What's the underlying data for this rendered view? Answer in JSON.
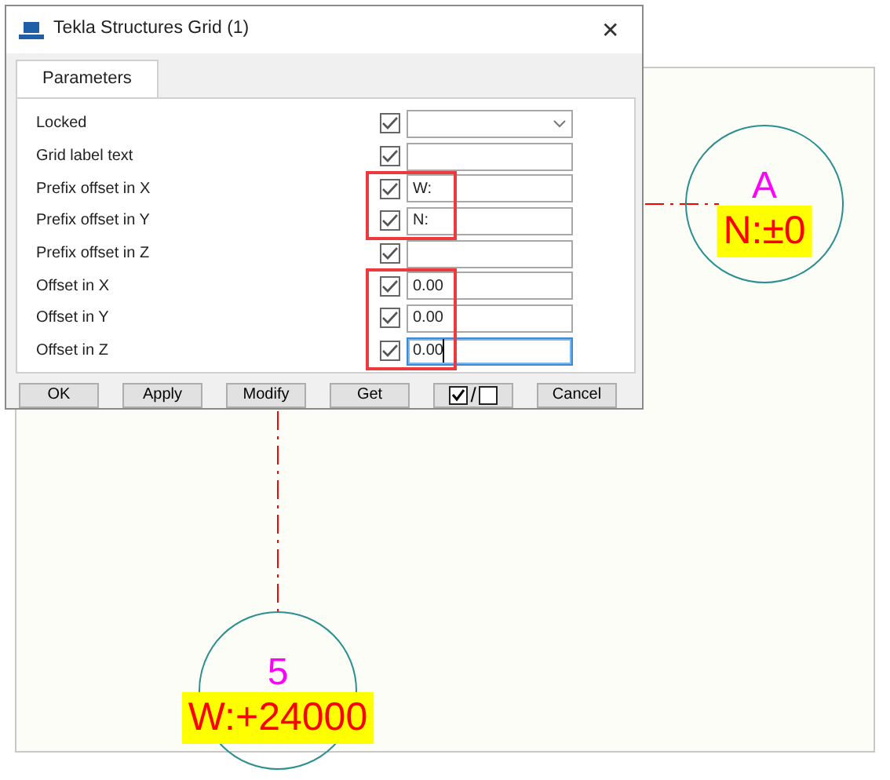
{
  "window": {
    "title": "Tekla Structures  Grid (1)",
    "close": "✕"
  },
  "tabs": [
    {
      "label": "Parameters",
      "selected": true
    }
  ],
  "rows": [
    {
      "label": "Locked",
      "checked": true,
      "kind": "dropdown",
      "value": "",
      "highlighted": false,
      "focused": false
    },
    {
      "label": "Grid label text",
      "checked": true,
      "kind": "text",
      "value": "",
      "highlighted": false,
      "focused": false
    },
    {
      "label": "Prefix offset in X",
      "checked": true,
      "kind": "text",
      "value": "W:",
      "highlighted": true,
      "focused": false
    },
    {
      "label": "Prefix offset in Y",
      "checked": true,
      "kind": "text",
      "value": "N:",
      "highlighted": true,
      "focused": false
    },
    {
      "label": "Prefix offset in Z",
      "checked": true,
      "kind": "text",
      "value": "",
      "highlighted": false,
      "focused": false
    },
    {
      "label": "Offset in X",
      "checked": true,
      "kind": "text",
      "value": "0.00",
      "highlighted": true,
      "focused": false
    },
    {
      "label": "Offset in Y",
      "checked": true,
      "kind": "text",
      "value": "0.00",
      "highlighted": true,
      "focused": false
    },
    {
      "label": "Offset in Z",
      "checked": true,
      "kind": "text",
      "value": "0.00",
      "highlighted": true,
      "focused": true
    }
  ],
  "buttons": [
    {
      "kind": "text",
      "label": "OK"
    },
    {
      "kind": "text",
      "label": "Apply"
    },
    {
      "kind": "text",
      "label": "Modify"
    },
    {
      "kind": "text",
      "label": "Get"
    },
    {
      "kind": "toggle",
      "label": "/"
    },
    {
      "kind": "text",
      "label": "Cancel"
    }
  ],
  "grid_lines": [
    {
      "kind": "horizontal",
      "name": "A",
      "label": "N:±0"
    },
    {
      "kind": "vertical",
      "name": "5",
      "label": "W:+24000"
    }
  ]
}
